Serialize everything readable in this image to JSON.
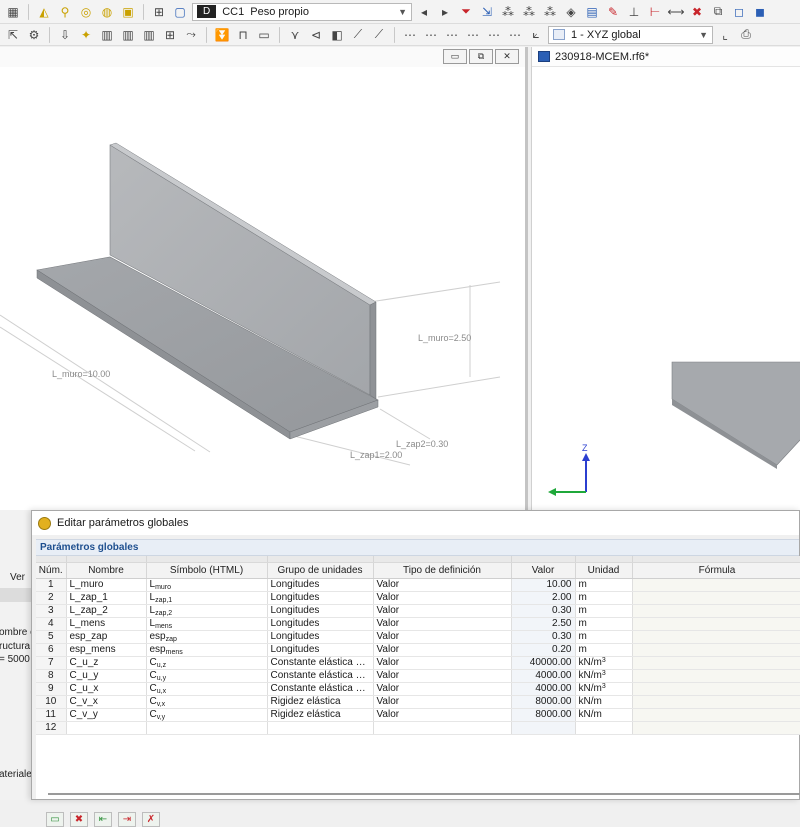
{
  "toolbar": {
    "loadcase_badge": "D",
    "loadcase_id": "CC1",
    "loadcase_name": "Peso propio",
    "coord_system": "1 - XYZ global"
  },
  "viewport_left": {
    "dimensions": {
      "l_muro_length": "L_muro=10.00",
      "l_muro_height": "L_muro=2.50",
      "zap1": "L_zap1=2.00",
      "zap2": "L_zap2=0.30"
    }
  },
  "viewport_right": {
    "title": "230918-MCEM.rf6*",
    "axis_z": "Z"
  },
  "left_panel": {
    "ver_label": "Ver",
    "nombre": "ombre c",
    "estructura": "ructura",
    "value": "= 5000",
    "materiales": "ateriale"
  },
  "dialog": {
    "title": "Editar parámetros globales",
    "section_title": "Parámetros globales",
    "columns": {
      "num": "Núm.",
      "nombre": "Nombre",
      "simbolo": "Símbolo (HTML)",
      "grupo": "Grupo de unidades",
      "tipo": "Tipo de definición",
      "valor": "Valor",
      "unidad": "Unidad",
      "formula": "Fórmula"
    },
    "rows": [
      {
        "num": "1",
        "nombre": "L_muro",
        "sym_base": "L",
        "sym_sub": "muro",
        "grupo": "Longitudes",
        "tipo": "Valor",
        "valor": "10.00",
        "unit_base": "m",
        "unit_sup": ""
      },
      {
        "num": "2",
        "nombre": "L_zap_1",
        "sym_base": "L",
        "sym_sub": "zap,1",
        "grupo": "Longitudes",
        "tipo": "Valor",
        "valor": "2.00",
        "unit_base": "m",
        "unit_sup": ""
      },
      {
        "num": "3",
        "nombre": "L_zap_2",
        "sym_base": "L",
        "sym_sub": "zap,2",
        "grupo": "Longitudes",
        "tipo": "Valor",
        "valor": "0.30",
        "unit_base": "m",
        "unit_sup": ""
      },
      {
        "num": "4",
        "nombre": "L_mens",
        "sym_base": "L",
        "sym_sub": "mens",
        "grupo": "Longitudes",
        "tipo": "Valor",
        "valor": "2.50",
        "unit_base": "m",
        "unit_sup": ""
      },
      {
        "num": "5",
        "nombre": "esp_zap",
        "sym_base": "esp",
        "sym_sub": "zap",
        "grupo": "Longitudes",
        "tipo": "Valor",
        "valor": "0.30",
        "unit_base": "m",
        "unit_sup": ""
      },
      {
        "num": "6",
        "nombre": "esp_mens",
        "sym_base": "esp",
        "sym_sub": "mens",
        "grupo": "Longitudes",
        "tipo": "Valor",
        "valor": "0.20",
        "unit_base": "m",
        "unit_sup": ""
      },
      {
        "num": "7",
        "nombre": "C_u_z",
        "sym_base": "C",
        "sym_sub": "u,z",
        "grupo": "Constante elástica de...",
        "tipo": "Valor",
        "valor": "40000.00",
        "unit_base": "kN/m",
        "unit_sup": "3"
      },
      {
        "num": "8",
        "nombre": "C_u_y",
        "sym_base": "C",
        "sym_sub": "u,y",
        "grupo": "Constante elástica de...",
        "tipo": "Valor",
        "valor": "4000.00",
        "unit_base": "kN/m",
        "unit_sup": "3"
      },
      {
        "num": "9",
        "nombre": "C_u_x",
        "sym_base": "C",
        "sym_sub": "u,x",
        "grupo": "Constante elástica de...",
        "tipo": "Valor",
        "valor": "4000.00",
        "unit_base": "kN/m",
        "unit_sup": "3"
      },
      {
        "num": "10",
        "nombre": "C_v_x",
        "sym_base": "C",
        "sym_sub": "v,x",
        "grupo": "Rigidez elástica",
        "tipo": "Valor",
        "valor": "8000.00",
        "unit_base": "kN/m",
        "unit_sup": ""
      },
      {
        "num": "11",
        "nombre": "C_v_y",
        "sym_base": "C",
        "sym_sub": "v,y",
        "grupo": "Rigidez elástica",
        "tipo": "Valor",
        "valor": "8000.00",
        "unit_base": "kN/m",
        "unit_sup": ""
      },
      {
        "num": "12",
        "nombre": "",
        "sym_base": "",
        "sym_sub": "",
        "grupo": "",
        "tipo": "",
        "valor": "",
        "unit_base": "",
        "unit_sup": ""
      }
    ]
  }
}
